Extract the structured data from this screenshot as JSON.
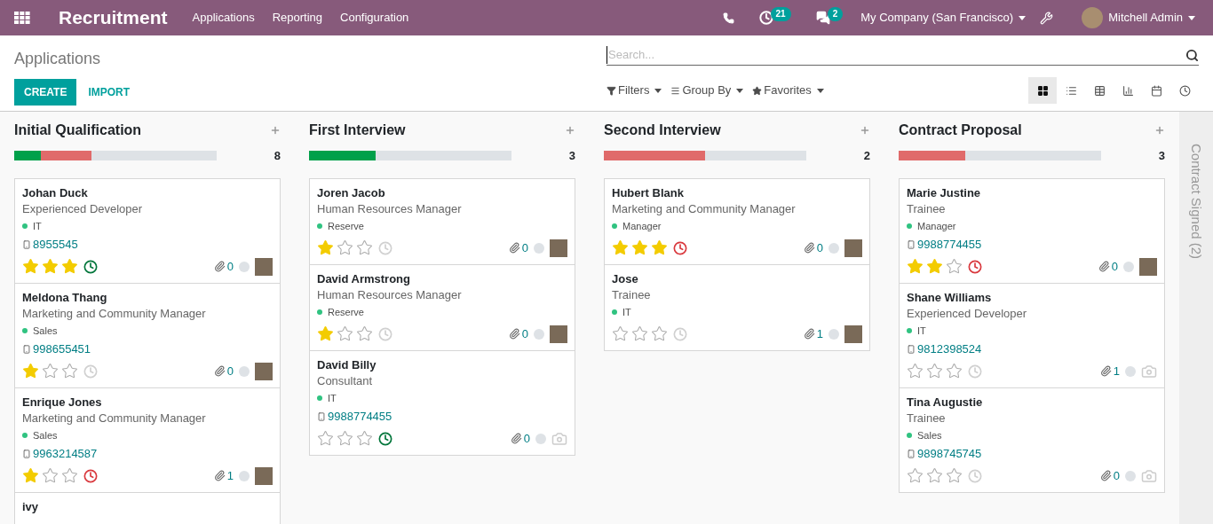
{
  "navbar": {
    "app_title": "Recruitment",
    "menu": [
      "Applications",
      "Reporting",
      "Configuration"
    ],
    "activity_count": "21",
    "message_count": "2",
    "company": "My Company (San Francisco)",
    "user": "Mitchell Admin"
  },
  "control_panel": {
    "breadcrumb": "Applications",
    "buttons": [
      "CREATE",
      "IMPORT"
    ],
    "search": {
      "placeholder": "Search..."
    },
    "search_options": [
      {
        "kind": "filter",
        "label": "Filters"
      },
      {
        "kind": "group",
        "label": "Group By"
      },
      {
        "kind": "favorite",
        "label": "Favorites"
      }
    ],
    "views": [
      {
        "kind": "kanban",
        "selected": true
      },
      {
        "kind": "list",
        "selected": false
      },
      {
        "kind": "pivot",
        "selected": false
      },
      {
        "kind": "graph",
        "selected": false
      },
      {
        "kind": "calendar",
        "selected": false
      },
      {
        "kind": "activity",
        "selected": false
      }
    ]
  },
  "columns": [
    {
      "title": "Initial Qualification",
      "count": "8",
      "progress": [
        {
          "color": "#00a04a",
          "level": 0.13
        },
        {
          "color": "#e06a6a",
          "level": 0.25
        }
      ],
      "cards": [
        {
          "name": "Johan Duck",
          "job": "Experienced Developer",
          "tag": "IT",
          "phone": "8955545",
          "stars": 3,
          "activity_scheduled": true,
          "activity_overdue": false,
          "attachments": "0",
          "has_photo": true
        },
        {
          "name": "Meldona Thang",
          "job": "Marketing and Community Manager",
          "tag": "Sales",
          "phone": "998655451",
          "stars": 1,
          "activity_scheduled": false,
          "attachments": "0",
          "has_photo": true
        },
        {
          "name": "Enrique Jones",
          "job": "Marketing and Community Manager",
          "tag": "Sales",
          "phone": "9963214587",
          "stars": 1,
          "activity_scheduled": true,
          "activity_overdue": true,
          "attachments": "1",
          "has_photo": true
        },
        {
          "name": "ivy"
        }
      ]
    },
    {
      "title": "First Interview",
      "count": "3",
      "progress": [
        {
          "color": "#00a04a",
          "level": 0.33
        }
      ],
      "cards": [
        {
          "name": "Joren Jacob",
          "job": "Human Resources Manager",
          "tag": "Reserve",
          "stars": 1,
          "activity_scheduled": false,
          "attachments": "0",
          "has_photo": true
        },
        {
          "name": "David Armstrong",
          "job": "Human Resources Manager",
          "tag": "Reserve",
          "stars": 1,
          "activity_scheduled": false,
          "attachments": "0",
          "has_photo": true
        },
        {
          "name": "David Billy",
          "job": "Consultant",
          "tag": "IT",
          "phone": "9988774455",
          "stars": 0,
          "activity_scheduled": true,
          "activity_overdue": false,
          "attachments": "0",
          "has_photo": false
        }
      ]
    },
    {
      "title": "Second Interview",
      "count": "2",
      "progress": [
        {
          "color": "#e06a6a",
          "level": 0.5
        }
      ],
      "cards": [
        {
          "name": "Hubert Blank",
          "job": "Marketing and Community Manager",
          "tag": "Manager",
          "stars": 3,
          "activity_scheduled": true,
          "activity_overdue": true,
          "attachments": "0",
          "has_photo": true
        },
        {
          "name": "Jose",
          "job": "Trainee",
          "tag": "IT",
          "stars": 0,
          "activity_scheduled": false,
          "attachments": "1",
          "has_photo": true
        }
      ]
    },
    {
      "title": "Contract Proposal",
      "count": "3",
      "progress": [
        {
          "color": "#e06a6a",
          "level": 0.33
        }
      ],
      "cards": [
        {
          "name": "Marie Justine",
          "job": "Trainee",
          "tag": "Manager",
          "phone": "9988774455",
          "stars": 2,
          "activity_scheduled": true,
          "activity_overdue": true,
          "attachments": "0",
          "has_photo": true
        },
        {
          "name": "Shane Williams",
          "job": "Experienced Developer",
          "tag": "IT",
          "phone": "9812398524",
          "stars": 0,
          "activity_scheduled": false,
          "attachments": "1",
          "has_photo": false
        },
        {
          "name": "Tina Augustie",
          "job": "Trainee",
          "tag": "Sales",
          "phone": "9898745745",
          "stars": 0,
          "activity_scheduled": false,
          "attachments": "0",
          "has_photo": false
        }
      ]
    }
  ],
  "folded_column": {
    "label": "Contract Signed (2)"
  }
}
